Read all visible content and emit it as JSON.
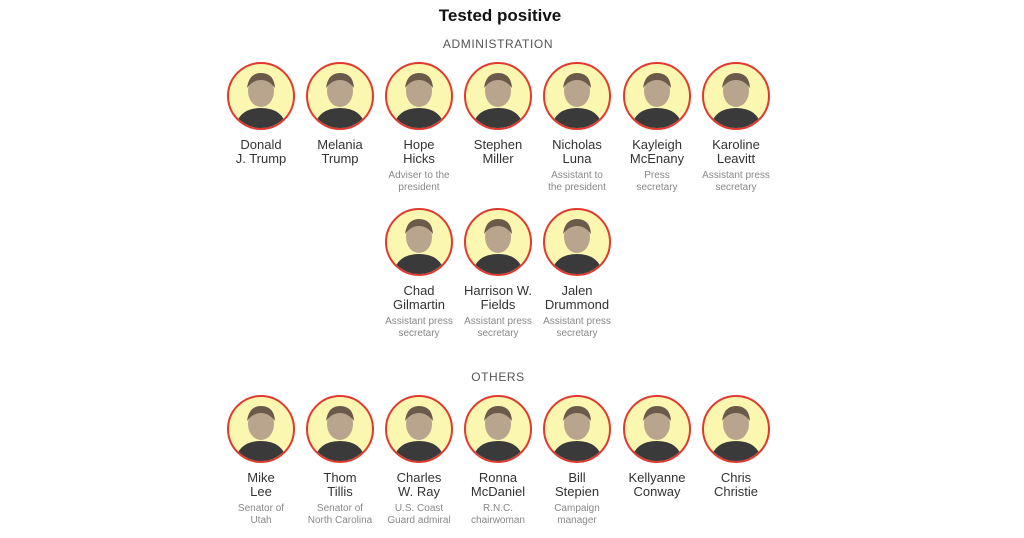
{
  "title": "Tested positive",
  "sections": [
    {
      "label": "ADMINISTRATION",
      "people": [
        {
          "name_lines": [
            "Donald",
            "J. Trump"
          ],
          "role_lines": []
        },
        {
          "name_lines": [
            "Melania",
            "Trump"
          ],
          "role_lines": []
        },
        {
          "name_lines": [
            "Hope",
            "Hicks"
          ],
          "role_lines": [
            "Adviser to the",
            "president"
          ]
        },
        {
          "name_lines": [
            "Stephen",
            "Miller"
          ],
          "role_lines": []
        },
        {
          "name_lines": [
            "Nicholas",
            "Luna"
          ],
          "role_lines": [
            "Assistant to",
            "the president"
          ]
        },
        {
          "name_lines": [
            "Kayleigh",
            "McEnany"
          ],
          "role_lines": [
            "Press",
            "secretary"
          ]
        },
        {
          "name_lines": [
            "Karoline",
            "Leavitt"
          ],
          "role_lines": [
            "Assistant press",
            "secretary"
          ]
        },
        {
          "name_lines": [
            "Chad",
            "Gilmartin"
          ],
          "role_lines": [
            "Assistant press",
            "secretary"
          ]
        },
        {
          "name_lines": [
            "Harrison W.",
            "Fields"
          ],
          "role_lines": [
            "Assistant press",
            "secretary"
          ]
        },
        {
          "name_lines": [
            "Jalen",
            "Drummond"
          ],
          "role_lines": [
            "Assistant press",
            "secretary"
          ]
        }
      ]
    },
    {
      "label": "OTHERS",
      "people": [
        {
          "name_lines": [
            "Mike",
            "Lee"
          ],
          "role_lines": [
            "Senator of",
            "Utah"
          ]
        },
        {
          "name_lines": [
            "Thom",
            "Tillis"
          ],
          "role_lines": [
            "Senator of",
            "North Carolina"
          ]
        },
        {
          "name_lines": [
            "Charles",
            "W. Ray"
          ],
          "role_lines": [
            "U.S. Coast",
            "Guard admiral"
          ]
        },
        {
          "name_lines": [
            "Ronna",
            "McDaniel"
          ],
          "role_lines": [
            "R.N.C.",
            "chairwoman"
          ]
        },
        {
          "name_lines": [
            "Bill",
            "Stepien"
          ],
          "role_lines": [
            "Campaign",
            "manager"
          ]
        },
        {
          "name_lines": [
            "Kellyanne",
            "Conway"
          ],
          "role_lines": []
        },
        {
          "name_lines": [
            "Chris",
            "Christie"
          ],
          "role_lines": []
        }
      ]
    }
  ],
  "colors": {
    "ring": "#e03a2f",
    "avatar_bg": "#fbf6b0",
    "name": "#333333",
    "role": "#888888"
  }
}
